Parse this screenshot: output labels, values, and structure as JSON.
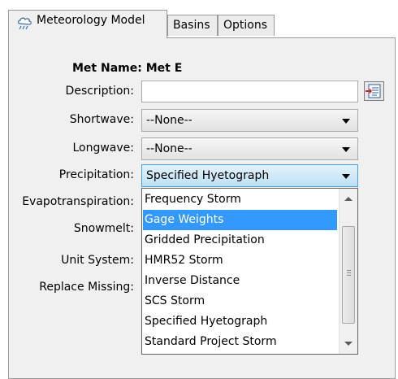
{
  "tabs": [
    {
      "label": "Meteorology Model",
      "active": true
    },
    {
      "label": "Basins",
      "active": false
    },
    {
      "label": "Options",
      "active": false
    }
  ],
  "form": {
    "met_name_label": "Met Name:",
    "met_name_value": "Met E",
    "description_label": "Description:",
    "description_value": "",
    "shortwave_label": "Shortwave:",
    "shortwave_value": "--None--",
    "longwave_label": "Longwave:",
    "longwave_value": "--None--",
    "precipitation_label": "Precipitation:",
    "precipitation_value": "Specified Hyetograph",
    "evapotranspiration_label": "Evapotranspiration:",
    "snowmelt_label": "Snowmelt:",
    "unit_system_label": "Unit System:",
    "replace_missing_label": "Replace Missing:"
  },
  "dropdown": {
    "items": [
      "Frequency Storm",
      "Gage Weights",
      "Gridded Precipitation",
      "HMR52 Storm",
      "Inverse Distance",
      "SCS Storm",
      "Specified Hyetograph",
      "Standard Project Storm"
    ],
    "highlighted": "Gage Weights",
    "highlight_color": "#3399ff"
  },
  "icons": {
    "tab_icon": "meteorology-cloud-icon",
    "edit_icon": "description-edit-icon"
  }
}
